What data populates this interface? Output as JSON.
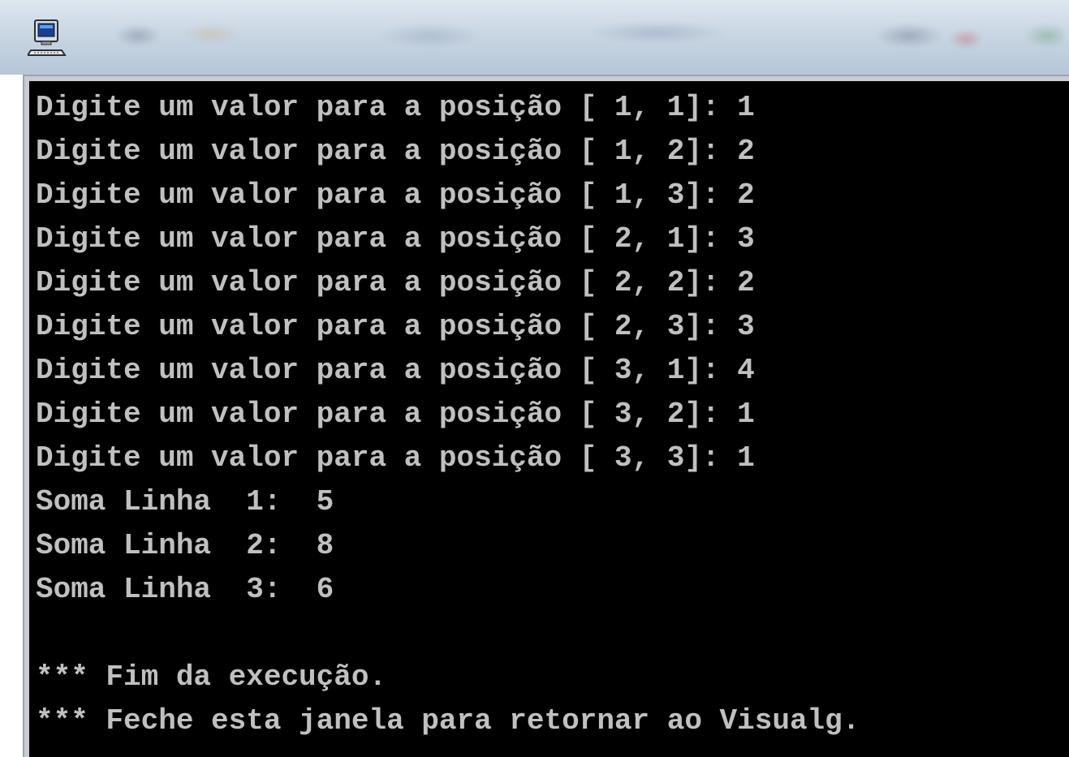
{
  "window": {
    "icon": "console-computer-icon"
  },
  "console": {
    "lines": [
      "Digite um valor para a posição [ 1, 1]: 1",
      "Digite um valor para a posição [ 1, 2]: 2",
      "Digite um valor para a posição [ 1, 3]: 2",
      "Digite um valor para a posição [ 2, 1]: 3",
      "Digite um valor para a posição [ 2, 2]: 2",
      "Digite um valor para a posição [ 2, 3]: 3",
      "Digite um valor para a posição [ 3, 1]: 4",
      "Digite um valor para a posição [ 3, 2]: 1",
      "Digite um valor para a posição [ 3, 3]: 1",
      "Soma Linha  1:  5",
      "Soma Linha  2:  8",
      "Soma Linha  3:  6",
      "",
      "*** Fim da execução.",
      "*** Feche esta janela para retornar ao Visualg."
    ],
    "colors": {
      "background": "#000000",
      "text": "#c0c0c0"
    }
  }
}
